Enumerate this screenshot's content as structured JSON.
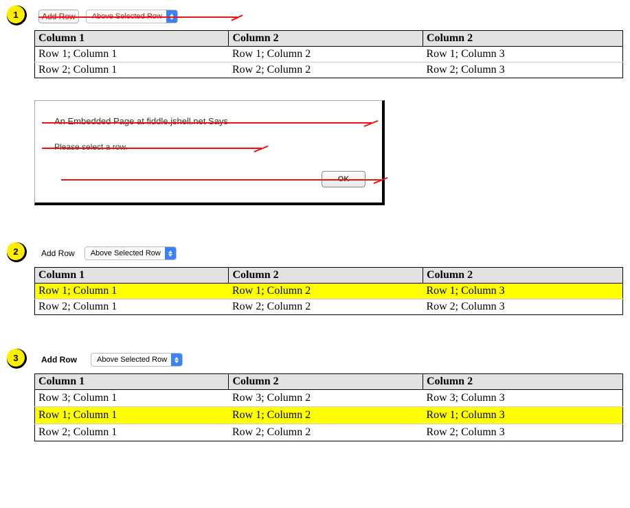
{
  "controls": {
    "add_row_label": "Add Row",
    "select_value": "Above Selected Row"
  },
  "columns": [
    "Column 1",
    "Column 2",
    "Column 2"
  ],
  "section1": {
    "rows": [
      [
        "Row 1; Column 1",
        "Row 1; Column 2",
        "Row 1; Column 3"
      ],
      [
        "Row 2; Column 1",
        "Row 2; Column 2",
        "Row 2; Column 3"
      ]
    ]
  },
  "dialog": {
    "title": "An Embedded Page at fiddle.jshell.net Says",
    "message": "Please select a row.",
    "ok_label": "OK"
  },
  "section2": {
    "highlighted_row_index": 0,
    "rows": [
      [
        "Row 1; Column 1",
        "Row 1; Column 2",
        "Row 1; Column 3"
      ],
      [
        "Row 2; Column 1",
        "Row 2; Column 2",
        "Row 2; Column 3"
      ]
    ]
  },
  "section3": {
    "highlighted_row_index": 1,
    "rows": [
      [
        "Row 3; Column 1",
        "Row 3; Column 2",
        "Row 3; Column 3"
      ],
      [
        "Row 1; Column 1",
        "Row 1; Column 2",
        "Row 1; Column 3"
      ],
      [
        "Row 2; Column 1",
        "Row 2; Column 2",
        "Row 2; Column 3"
      ]
    ]
  },
  "badges": {
    "1": "1",
    "2": "2",
    "3": "3"
  }
}
